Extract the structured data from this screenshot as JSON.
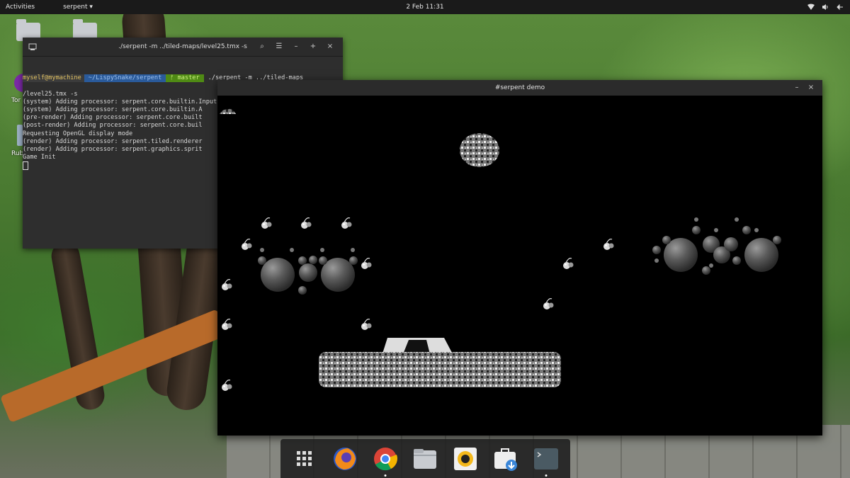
{
  "topbar": {
    "activities": "Activities",
    "app_menu": "serpent ▾",
    "clock": "2 Feb  11:31",
    "icons": [
      "network-icon",
      "volume-icon",
      "power-icon"
    ]
  },
  "desktop": {
    "icons": [
      {
        "name": "folder-icon",
        "label": ""
      },
      {
        "name": "folder-icon",
        "label": ""
      },
      {
        "name": "app-icon",
        "label": "Tor"
      },
      {
        "name": "app-icon",
        "label": "Rub"
      }
    ]
  },
  "terminal": {
    "title": "./serpent -m ../tiled-maps/level25.tmx -s",
    "prompt_user": "myself@mymachine",
    "prompt_path": "~/LispySnake/serpent",
    "prompt_git": "ᚠ master",
    "prompt_cmd": "./serpent -m ../tiled-maps",
    "lines": [
      "/level25.tmx -s",
      "(system) Adding processor: serpent.core.builtin.InputProcessor",
      "(system) Adding processor: serpent.core.builtin.A",
      "(pre-render) Adding processor: serpent.core.built",
      "(post-render) Adding processor: serpent.core.buil",
      "Requesting OpenGL display mode",
      "(render) Adding processor: serpent.tiled.renderer",
      "(render) Adding processor: serpent.graphics.sprit",
      "Game Init"
    ],
    "buttons": {
      "search": "⌕",
      "menu": "☰",
      "minimize": "–",
      "maximize": "+",
      "close": "×"
    }
  },
  "game": {
    "title": "#serpent demo",
    "buttons": {
      "minimize": "–",
      "close": "×"
    }
  },
  "dock": {
    "items": [
      {
        "name": "app-grid-icon",
        "running": false
      },
      {
        "name": "firefox-icon",
        "running": false
      },
      {
        "name": "chrome-icon",
        "running": true
      },
      {
        "name": "files-icon",
        "running": false
      },
      {
        "name": "rhythmbox-icon",
        "running": false
      },
      {
        "name": "software-icon",
        "running": false
      },
      {
        "name": "terminal-icon",
        "running": true
      }
    ]
  },
  "colors": {
    "topbar": "#1a1a1a",
    "path_segment": "#2a5a9a",
    "git_segment": "#4f8a14",
    "user_text": "#e0c060"
  }
}
